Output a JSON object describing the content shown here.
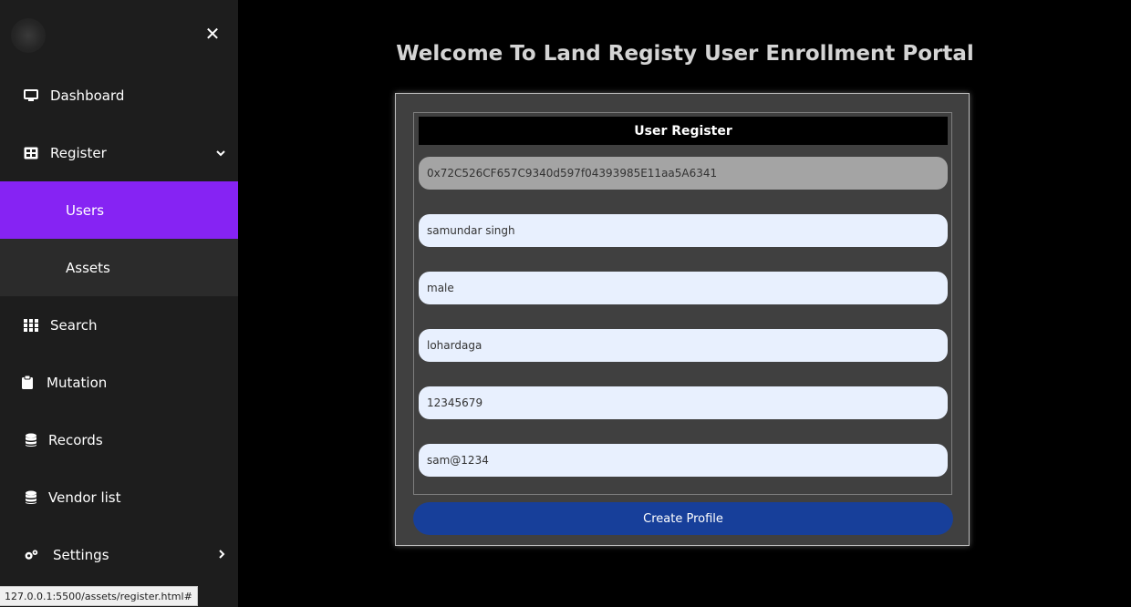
{
  "page_title": "Welcome To Land Registy User Enrollment Portal",
  "sidebar": {
    "close_glyph": "✕",
    "items": {
      "dashboard": "Dashboard",
      "register": "Register",
      "users": "Users",
      "assets": "Assets",
      "search": "Search",
      "mutation": "Mutation",
      "records": "Records",
      "vendor_list": "Vendor list",
      "settings": "Settings"
    }
  },
  "form": {
    "heading": "User Register",
    "fields": {
      "address": "0x72C526CF657C9340d597f04393985E11aa5A6341",
      "name": "samundar singh",
      "gender": "male",
      "location": "lohardaga",
      "phone": "12345679",
      "password": "sam@1234"
    },
    "submit_label": "Create Profile"
  },
  "status_bar": "127.0.0.1:5500/assets/register.html#",
  "colors": {
    "accent_active": "#8623f3",
    "button": "#173f9a",
    "sidebar_bg": "#1d1d1d",
    "panel_bg": "#404040"
  }
}
